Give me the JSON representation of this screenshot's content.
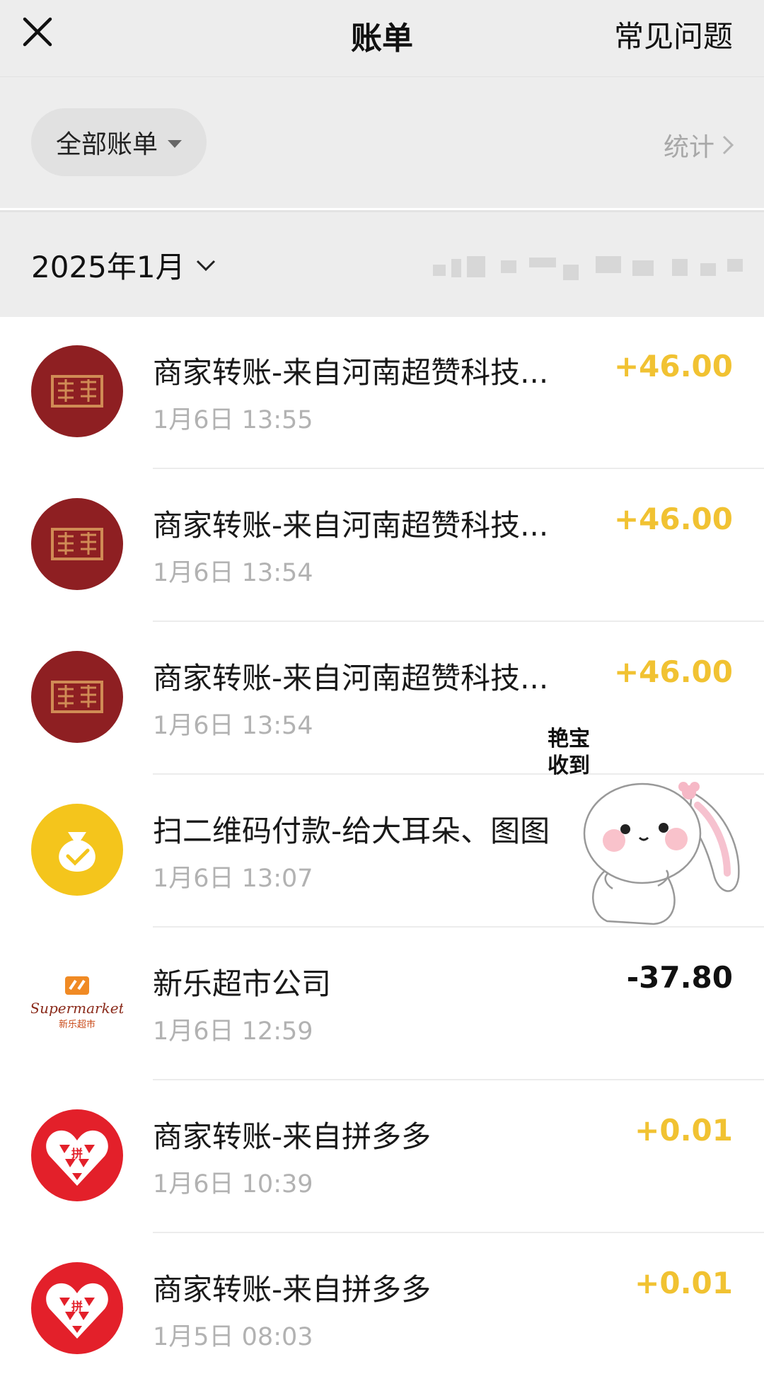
{
  "header": {
    "title": "账单",
    "faq_label": "常见问题"
  },
  "filter": {
    "selected": "全部账单",
    "stats_label": "统计"
  },
  "month": {
    "label": "2025年1月"
  },
  "transactions": [
    {
      "title": "商家转账-来自河南超赞科技...",
      "time": "1月6日 13:55",
      "amount": "+46.00",
      "icon": "chaozan-logo"
    },
    {
      "title": "商家转账-来自河南超赞科技...",
      "time": "1月6日 13:54",
      "amount": "+46.00",
      "icon": "chaozan-logo"
    },
    {
      "title": "商家转账-来自河南超赞科技...",
      "time": "1月6日 13:54",
      "amount": "+46.00",
      "icon": "chaozan-logo"
    },
    {
      "title": "扫二维码付款-给大耳朵、图图",
      "time": "1月6日 13:07",
      "amount": "",
      "icon": "money-bag-icon"
    },
    {
      "title": "新乐超市公司",
      "time": "1月6日 12:59",
      "amount": "-37.80",
      "icon": "supermarket-logo",
      "logo_text": "Supermarket",
      "logo_sub": "新乐超市"
    },
    {
      "title": "商家转账-来自拼多多",
      "time": "1月6日 10:39",
      "amount": "+0.01",
      "icon": "pinduoduo-logo"
    },
    {
      "title": "商家转账-来自拼多多",
      "time": "1月5日 08:03",
      "amount": "+0.01",
      "icon": "pinduoduo-logo"
    }
  ],
  "sticker": {
    "caption_line1": "艳宝",
    "caption_line2": "收到",
    "icon": "bunny-sticker"
  },
  "colors": {
    "income": "#f1c232",
    "expense": "#111111",
    "chaozan": "#8e1f22",
    "money_bag": "#f4c51c",
    "pinduoduo": "#e3202a"
  }
}
